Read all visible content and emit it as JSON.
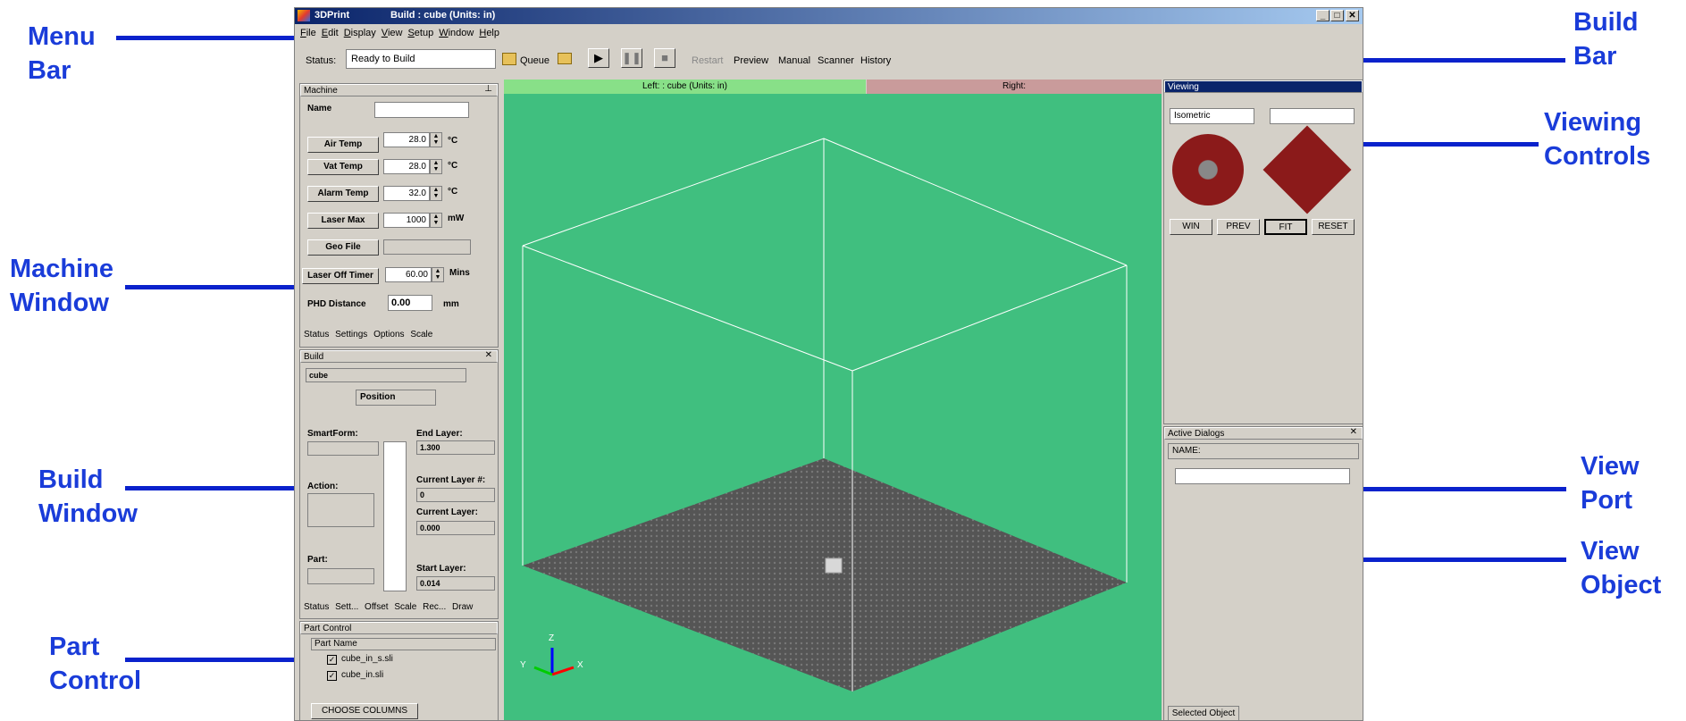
{
  "annotations": {
    "menu_bar": [
      "Menu",
      "Bar"
    ],
    "machine_window": [
      "Machine",
      "Window"
    ],
    "build_window": [
      "Build",
      "Window"
    ],
    "part_control": [
      "Part",
      "Control"
    ],
    "build_bar": [
      "Build",
      "Bar"
    ],
    "viewing_controls": [
      "Viewing",
      "Controls"
    ],
    "view_port": [
      "View",
      "Port"
    ],
    "view_object": [
      "View",
      "Object"
    ]
  },
  "window": {
    "app_name": "3DPrint",
    "title": "Build : cube (Units: in)",
    "minimize": "_",
    "maximize": "□",
    "close": "✕"
  },
  "menu": [
    "File",
    "Edit",
    "Display",
    "View",
    "Setup",
    "Window",
    "Help"
  ],
  "buildbar": {
    "status_label": "Status:",
    "status_value": "Ready to Build",
    "queue": "Queue",
    "restart": "Restart",
    "preview": "Preview",
    "manual": "Manual",
    "scanner": "Scanner",
    "history": "History"
  },
  "machine": {
    "header": "Machine",
    "name_label": "Name",
    "air_temp": {
      "label": "Air Temp",
      "value": "28.0",
      "unit": "°C"
    },
    "vat_temp": {
      "label": "Vat Temp",
      "value": "28.0",
      "unit": "°C"
    },
    "alarm_temp": {
      "label": "Alarm Temp",
      "value": "32.0",
      "unit": "°C"
    },
    "laser_max": {
      "label": "Laser Max",
      "value": "1000",
      "unit": "mW"
    },
    "geo_file": {
      "label": "Geo File"
    },
    "laser_off": {
      "label": "Laser Off Timer",
      "value": "60.00",
      "unit": "Mins"
    },
    "phd": {
      "label": "PHD Distance",
      "value": "0.00",
      "unit": "mm"
    },
    "tabs": [
      "Status",
      "Settings",
      "Options",
      "Scale"
    ]
  },
  "build": {
    "header": "Build",
    "name": "cube",
    "mode": "Position",
    "smartform_label": "SmartForm:",
    "action_label": "Action:",
    "part_label": "Part:",
    "end_layer_label": "End Layer:",
    "end_layer_value": "1.300",
    "current_layer_num_label": "Current Layer #:",
    "current_layer_num_value": "0",
    "current_layer_label": "Current Layer:",
    "current_layer_value": "0.000",
    "start_layer_label": "Start Layer:",
    "start_layer_value": "0.014",
    "tabs": [
      "Status",
      "Sett...",
      "Offset",
      "Scale",
      "Rec...",
      "Draw"
    ]
  },
  "part_control": {
    "header": "Part Control",
    "column": "Part Name",
    "parts": [
      "cube_in_s.sli",
      "cube_in.sli"
    ],
    "choose_columns": "CHOOSE COLUMNS"
  },
  "viewport": {
    "left_tab": "Left: : cube (Units: in)",
    "right_tab": "Right:",
    "axis_x": "X",
    "axis_y": "Y",
    "axis_z": "Z",
    "bg_color": "#40bf7f"
  },
  "viewing": {
    "header": "Viewing",
    "projection": "Isometric",
    "buttons": [
      "WIN",
      "PREV",
      "FIT",
      "RESET"
    ]
  },
  "active_dialogs": {
    "header": "Active Dialogs",
    "name_label": "NAME:",
    "selected_tab": "Selected Object"
  }
}
